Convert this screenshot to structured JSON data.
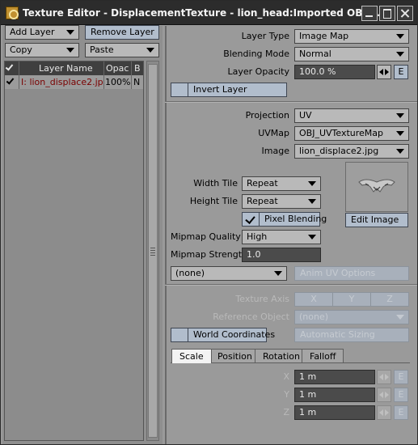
{
  "window": {
    "title": "Texture Editor - DisplacementTexture - lion_head:Imported OBJ ..."
  },
  "left": {
    "add_layer": "Add Layer",
    "remove_layer": "Remove Layer",
    "copy": "Copy",
    "paste": "Paste",
    "columns": {
      "name": "Layer Name",
      "opacity": "Opac",
      "blend": "B"
    },
    "layers": [
      {
        "name": "I: lion_displace2.jpg",
        "opacity": "100%",
        "blend": "N",
        "enabled": true
      }
    ]
  },
  "layer": {
    "type_label": "Layer Type",
    "type_value": "Image Map",
    "blend_label": "Blending Mode",
    "blend_value": "Normal",
    "opacity_label": "Layer Opacity",
    "opacity_value": "100.0 %",
    "e": "E",
    "invert_label": "Invert Layer",
    "invert_on": false
  },
  "image": {
    "projection_label": "Projection",
    "projection_value": "UV",
    "uvmap_label": "UVMap",
    "uvmap_value": "OBJ_UVTextureMap",
    "image_label": "Image",
    "image_value": "lion_displace2.jpg",
    "width_tile_label": "Width Tile",
    "width_tile_value": "Repeat",
    "height_tile_label": "Height Tile",
    "height_tile_value": "Repeat",
    "pixel_blending_label": "Pixel Blending",
    "pixel_blending_on": true,
    "edit_image": "Edit Image",
    "mipmap_quality_label": "Mipmap Quality",
    "mipmap_quality_value": "High",
    "mipmap_strength_label": "Mipmap Strength",
    "mipmap_strength_value": "1.0",
    "none_value": "(none)",
    "anim_uv": "Anim UV Options"
  },
  "axis": {
    "texture_axis_label": "Texture Axis",
    "axes": [
      "X",
      "Y",
      "Z"
    ],
    "reference_label": "Reference Object",
    "reference_value": "(none)",
    "world_coords_label": "World Coordinates",
    "auto_sizing": "Automatic Sizing"
  },
  "tabs": [
    "Scale",
    "Position",
    "Rotation",
    "Falloff"
  ],
  "active_tab": "Scale",
  "scale": [
    {
      "axis": "X",
      "value": "1 m"
    },
    {
      "axis": "Y",
      "value": "1 m"
    },
    {
      "axis": "Z",
      "value": "1 m"
    }
  ],
  "colors": {
    "title_bar": "#2c2c2c",
    "button": "#b1bdcc",
    "field": "#4b4b4b",
    "layer_name": "#7a0000"
  }
}
